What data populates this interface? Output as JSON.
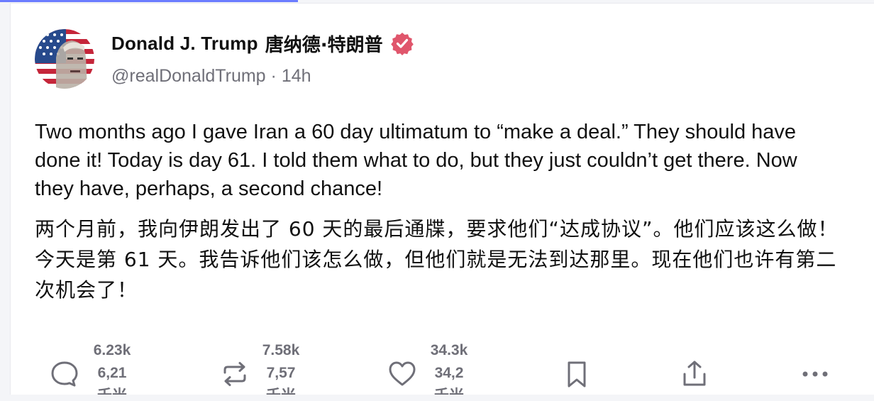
{
  "author": {
    "name": "Donald J. Trump",
    "name_cn": "唐纳德·特朗普",
    "handle": "@realDonaldTrump",
    "separator": "·",
    "time": "14h"
  },
  "post": {
    "text_en": "Two months ago I gave Iran a 60 day ultimatum to “make a deal.” They should have done it! Today is day 61. I told them what to do, but they just couldn’t get there. Now they have, perhaps, a second chance!",
    "text_cn": "两个月前，我向伊朗发出了 60 天的最后通牒，要求他们“达成协议”。他们应该这么做！今天是第 61 天。我告诉他们该怎么做，但他们就是无法到达那里。现在他们也许有第二次机会了！"
  },
  "actions": {
    "reply": {
      "count": "6.23k",
      "count_alt": "6,21",
      "count_cn": "千米"
    },
    "repost": {
      "count": "7.58k",
      "count_alt": "7,57",
      "count_cn": "千米"
    },
    "like": {
      "count": "34.3k",
      "count_alt": "34,2",
      "count_cn": "千米"
    }
  },
  "icons": {
    "reply": "speech-bubble-icon",
    "repost": "repost-arrows-icon",
    "like": "heart-icon",
    "bookmark": "bookmark-icon",
    "share": "share-icon",
    "more": "more-dots-icon",
    "verified": "verified-badge-icon"
  },
  "colors": {
    "verified": "#e0566c",
    "muted": "#6f6f78",
    "accent_line": "#6b7cff"
  }
}
